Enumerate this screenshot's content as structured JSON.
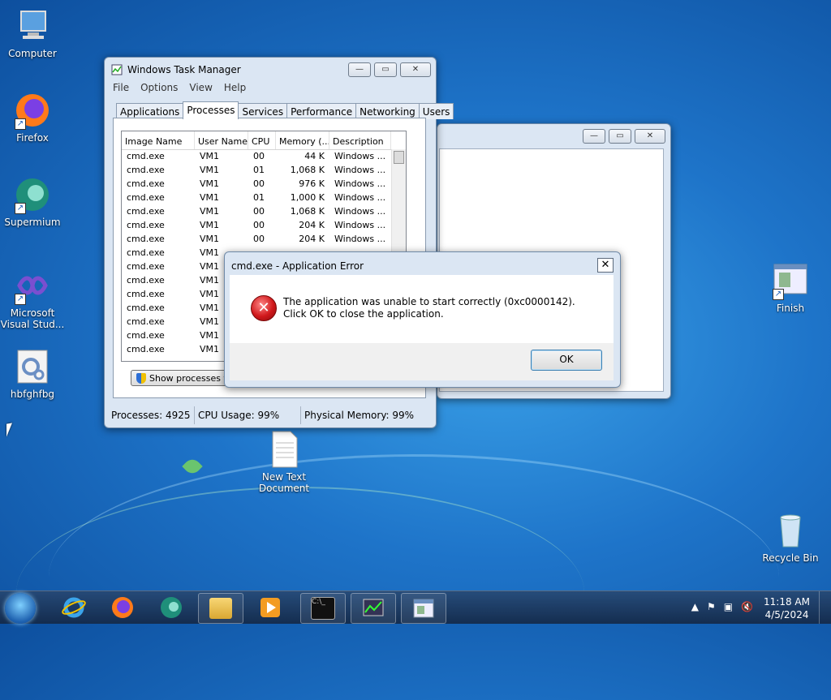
{
  "desktop": {
    "icons": [
      {
        "label": "Computer",
        "icon": "computer-icon"
      },
      {
        "label": "Firefox",
        "icon": "firefox-icon"
      },
      {
        "label": "Supermium",
        "icon": "supermium-icon"
      },
      {
        "label": "Microsoft Visual Stud...",
        "icon": "visual-studio-icon"
      },
      {
        "label": "hbfghfbg",
        "icon": "settings-file-icon"
      },
      {
        "label": "New Text Document",
        "icon": "text-document-icon"
      },
      {
        "label": "Finish",
        "icon": "app-shortcut-icon"
      },
      {
        "label": "Recycle Bin",
        "icon": "recycle-bin-icon"
      }
    ]
  },
  "task_manager": {
    "title": "Windows Task Manager",
    "menu": [
      "File",
      "Options",
      "View",
      "Help"
    ],
    "tabs": [
      "Applications",
      "Processes",
      "Services",
      "Performance",
      "Networking",
      "Users"
    ],
    "active_tab": "Processes",
    "columns": [
      "Image Name",
      "User Name",
      "CPU",
      "Memory (...",
      "Description"
    ],
    "rows": [
      [
        "cmd.exe",
        "VM1",
        "00",
        "44 K",
        "Windows ..."
      ],
      [
        "cmd.exe",
        "VM1",
        "01",
        "1,068 K",
        "Windows ..."
      ],
      [
        "cmd.exe",
        "VM1",
        "00",
        "976 K",
        "Windows ..."
      ],
      [
        "cmd.exe",
        "VM1",
        "01",
        "1,000 K",
        "Windows ..."
      ],
      [
        "cmd.exe",
        "VM1",
        "00",
        "1,068 K",
        "Windows ..."
      ],
      [
        "cmd.exe",
        "VM1",
        "00",
        "204 K",
        "Windows ..."
      ],
      [
        "cmd.exe",
        "VM1",
        "00",
        "204 K",
        "Windows ..."
      ],
      [
        "cmd.exe",
        "VM1",
        "",
        "",
        ""
      ],
      [
        "cmd.exe",
        "VM1",
        "",
        "",
        ""
      ],
      [
        "cmd.exe",
        "VM1",
        "",
        "",
        ""
      ],
      [
        "cmd.exe",
        "VM1",
        "",
        "",
        ""
      ],
      [
        "cmd.exe",
        "VM1",
        "",
        "",
        ""
      ],
      [
        "cmd.exe",
        "VM1",
        "",
        "",
        ""
      ],
      [
        "cmd.exe",
        "VM1",
        "",
        "",
        ""
      ],
      [
        "cmd.exe",
        "VM1",
        "",
        "",
        ""
      ]
    ],
    "show_button": "Show processes fro",
    "status": {
      "processes": "Processes: 4925",
      "cpu": "CPU Usage: 99%",
      "memory": "Physical Memory: 99%"
    }
  },
  "error_dialog": {
    "title": "cmd.exe - Application Error",
    "message": "The application was unable to start correctly (0xc0000142). Click OK to close the application.",
    "ok_label": "OK",
    "icon": "error-icon"
  },
  "taskbar": {
    "clock_time": "11:18 AM",
    "clock_date": "4/5/2024",
    "pinned": [
      "internet-explorer-icon",
      "firefox-icon",
      "supermium-icon",
      "file-explorer-icon",
      "media-player-icon",
      "cmd-icon",
      "task-manager-icon",
      "window-app-icon"
    ]
  },
  "colors": {
    "accent": "#1e74c9",
    "error": "#d0181b"
  }
}
